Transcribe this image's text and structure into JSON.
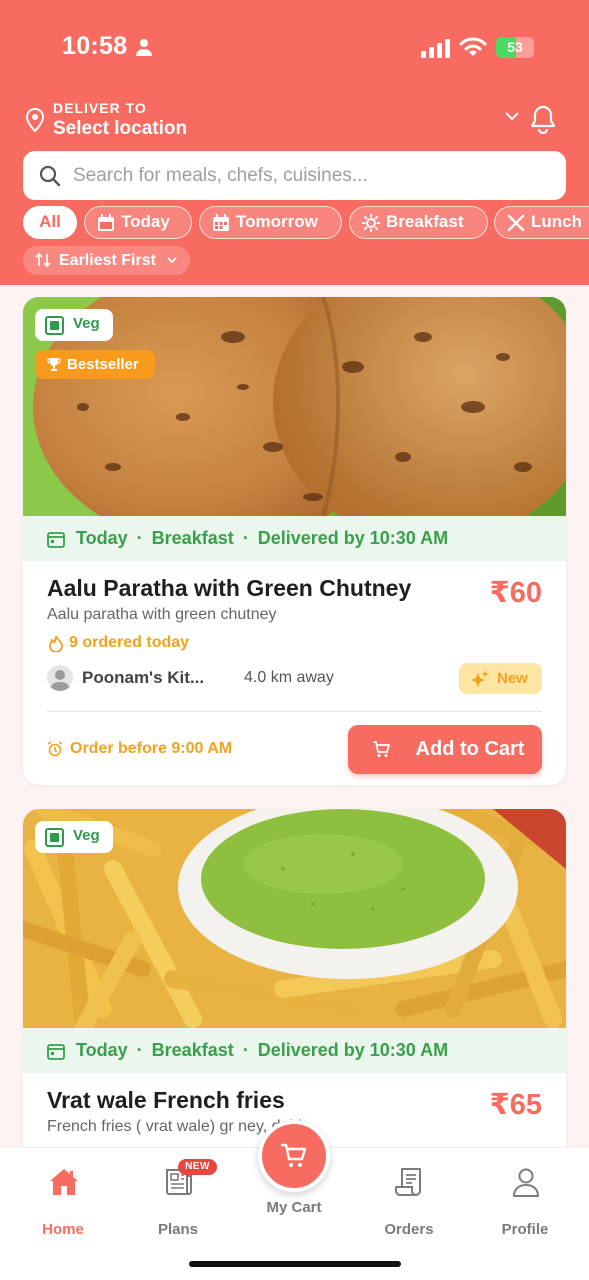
{
  "status_bar": {
    "time": "10:58",
    "battery": "53",
    "battery_level": 0.53
  },
  "location": {
    "label": "DELIVER TO",
    "value": "Select location"
  },
  "search": {
    "placeholder": "Search for meals, chefs, cuisines..."
  },
  "filters": [
    {
      "label": "All",
      "icon": "none",
      "active": true
    },
    {
      "label": "Today",
      "icon": "calendar-icon"
    },
    {
      "label": "Tomorrow",
      "icon": "calendar-grid-icon"
    },
    {
      "label": "Breakfast",
      "icon": "sun-icon"
    },
    {
      "label": "Lunch",
      "icon": "fork-knife-icon"
    }
  ],
  "sort": {
    "label": "Earliest First"
  },
  "cards": [
    {
      "veg_label": "Veg",
      "bestseller_label": "Bestseller",
      "day": "Today",
      "meal": "Breakfast",
      "delivery": "Delivered by 10:30 AM",
      "title": "Aalu Paratha with Green Chutney",
      "price": "₹60",
      "description": "Aalu paratha with green chutney",
      "ordered": "9 ordered today",
      "chef": "Poonam's Kit...",
      "distance": "4.0 km away",
      "new_label": "New",
      "order_before": "Order before 9:00 AM",
      "cta": "Add to Cart"
    },
    {
      "veg_label": "Veg",
      "day": "Today",
      "meal": "Breakfast",
      "delivery": "Delivered by 10:30 AM",
      "title": "Vrat wale French fries",
      "price": "₹65",
      "description": "French fries ( vrat wale) gr          ney, dahi"
    }
  ],
  "nav": {
    "home": "Home",
    "plans": "Plans",
    "plans_badge": "NEW",
    "cart": "My Cart",
    "orders": "Orders",
    "profile": "Profile"
  },
  "colors": {
    "brand": "#f76b61",
    "veg_green": "#2f9a4a",
    "accent_orange": "#f2a21c"
  }
}
